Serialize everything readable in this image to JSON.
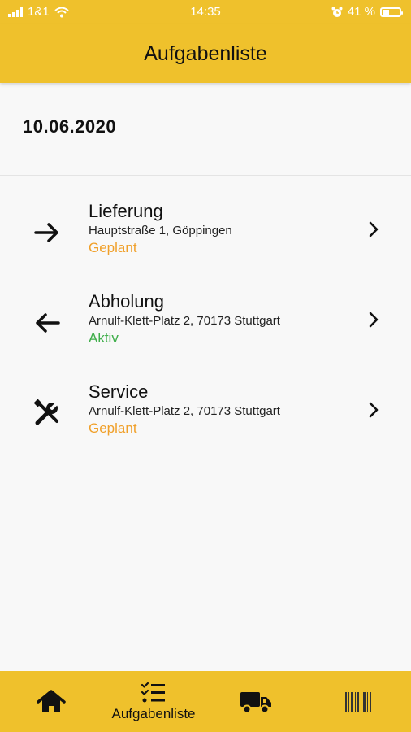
{
  "status_bar": {
    "carrier": "1&1",
    "time": "14:35",
    "battery_percent": "41 %",
    "battery_level": 0.41
  },
  "header": {
    "title": "Aufgabenliste"
  },
  "date": "10.06.2020",
  "tasks": [
    {
      "icon": "arrow-right-icon",
      "title": "Lieferung",
      "address": "Hauptstraße 1,  Göppingen",
      "status": "Geplant",
      "status_color": "#f0a02a"
    },
    {
      "icon": "arrow-left-icon",
      "title": "Abholung",
      "address": "Arnulf-Klett-Platz  2, 70173 Stuttgart",
      "status": "Aktiv",
      "status_color": "#3fae4a"
    },
    {
      "icon": "tools-icon",
      "title": "Service",
      "address": "Arnulf-Klett-Platz  2, 70173 Stuttgart",
      "status": "Geplant",
      "status_color": "#f0a02a"
    }
  ],
  "bottom_nav": {
    "items": [
      {
        "icon": "home-icon",
        "label": ""
      },
      {
        "icon": "checklist-icon",
        "label": "Aufgabenliste",
        "active": true
      },
      {
        "icon": "truck-icon",
        "label": ""
      },
      {
        "icon": "barcode-icon",
        "label": ""
      }
    ]
  },
  "colors": {
    "accent": "#efc12c",
    "planned": "#f0a02a",
    "active": "#3fae4a"
  }
}
